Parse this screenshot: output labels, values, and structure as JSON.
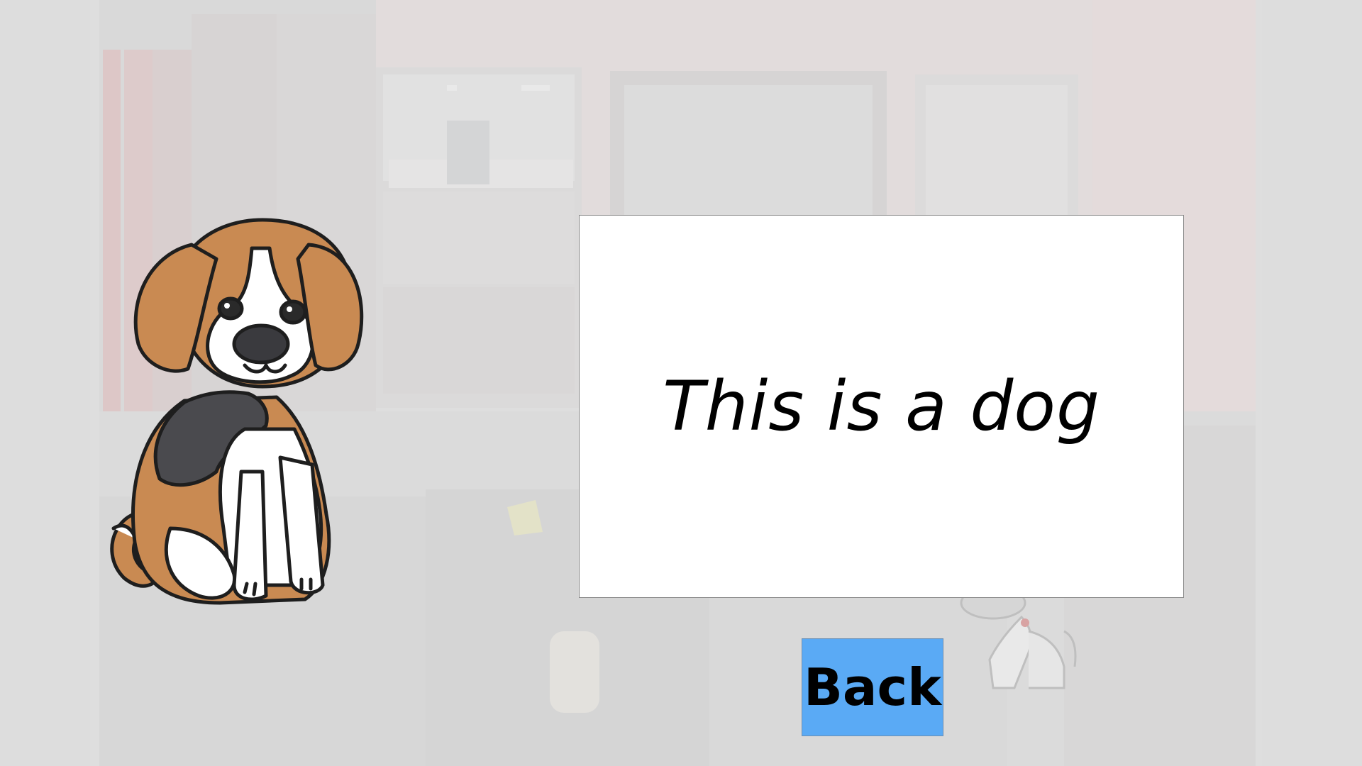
{
  "scene": {
    "background_description_colors": {
      "wall": "#e6d6d6",
      "curtain": "#dba9a9",
      "floor": "#d8d8d8"
    }
  },
  "card": {
    "text": "This is a dog"
  },
  "navigation": {
    "back_label": "Back"
  },
  "colors": {
    "back_button": "#5aaaf5",
    "card_background": "#ffffff",
    "dog_brown": "#c98a52",
    "dog_black": "#4a4a4e"
  }
}
